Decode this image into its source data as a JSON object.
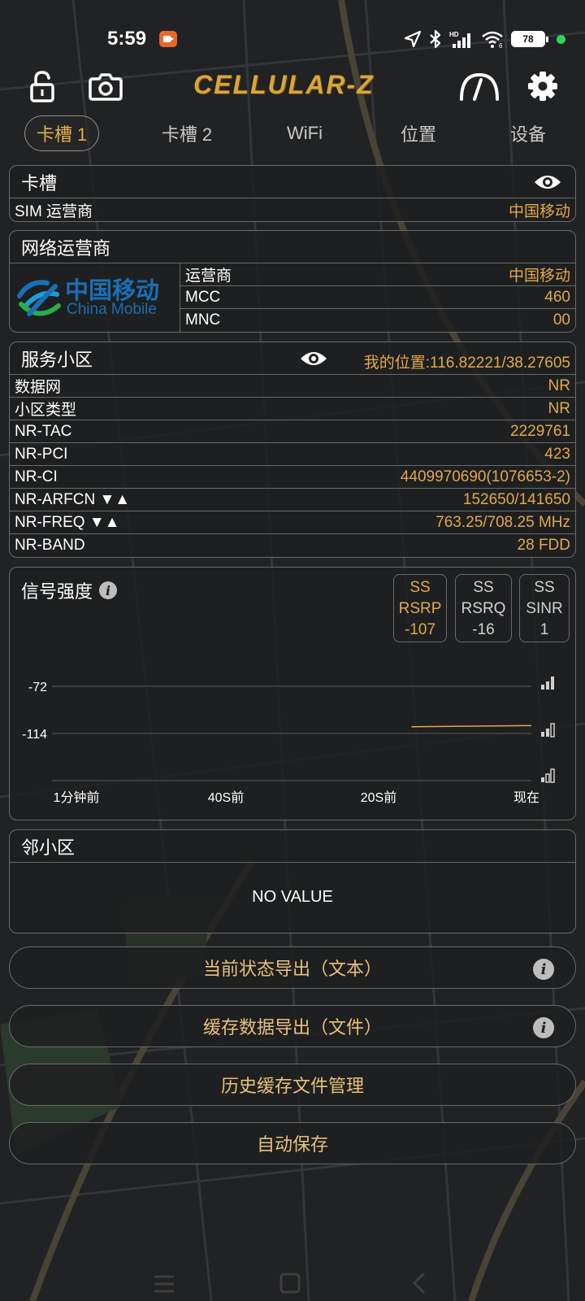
{
  "status_bar": {
    "time": "5:59",
    "battery": "78",
    "icons": [
      "recording-icon",
      "location-arrow-icon",
      "bluetooth-icon",
      "signal-hd-icon",
      "wifi-icon",
      "battery-icon"
    ]
  },
  "toolbar": {
    "app_title": "CELLULAR-Z",
    "icons": [
      "lock-icon",
      "camera-icon",
      "speedometer-icon",
      "gear-icon"
    ]
  },
  "tabs": [
    {
      "label": "卡槽 1",
      "active": true
    },
    {
      "label": "卡槽 2",
      "active": false
    },
    {
      "label": "WiFi",
      "active": false
    },
    {
      "label": "位置",
      "active": false
    },
    {
      "label": "设备",
      "active": false
    }
  ],
  "slot_card": {
    "title": "卡槽",
    "rows": [
      {
        "key": "SIM 运营商",
        "value": "中国移动"
      }
    ]
  },
  "operator_card": {
    "title": "网络运营商",
    "logo_cn": "中国移动",
    "logo_en": "China Mobile",
    "rows": [
      {
        "key": "运营商",
        "value": "中国移动"
      },
      {
        "key": "MCC",
        "value": "460"
      },
      {
        "key": "MNC",
        "value": "00"
      }
    ]
  },
  "serving_card": {
    "title": "服务小区",
    "location": "我的位置:116.82221/38.27605",
    "rows": [
      {
        "key": "数据网",
        "value": "NR"
      },
      {
        "key": "小区类型",
        "value": "NR"
      },
      {
        "key": "NR-TAC",
        "value": "2229761"
      },
      {
        "key": "NR-PCI",
        "value": "423"
      },
      {
        "key": "NR-CI",
        "value": "4409970690(1076653-2)"
      },
      {
        "key": "NR-ARFCN ▼▲",
        "value": "152650/141650"
      },
      {
        "key": "NR-FREQ ▼▲",
        "value": "763.25/708.25 MHz"
      },
      {
        "key": "NR-BAND",
        "value": "28 FDD"
      }
    ]
  },
  "signal_card": {
    "title": "信号强度",
    "metrics": [
      {
        "line1": "SS",
        "line2": "RSRP",
        "line3": "-107",
        "selected": true
      },
      {
        "line1": "SS",
        "line2": "RSRQ",
        "line3": "-16",
        "selected": false
      },
      {
        "line1": "SS",
        "line2": "SINR",
        "line3": "1",
        "selected": false
      }
    ]
  },
  "chart_data": {
    "type": "line",
    "y_ticks": [
      "-72",
      "-114"
    ],
    "x_labels": [
      "1分钟前",
      "40S前",
      "20S前",
      "现在"
    ],
    "series": [
      {
        "color": "#e0a94a",
        "x": [
          -15,
          0
        ],
        "y": [
          -108,
          -107
        ]
      }
    ],
    "xlim": [
      -60,
      0
    ],
    "ylim": [
      -156,
      -72
    ]
  },
  "neighbor_card": {
    "title": "邻小区",
    "empty_text": "NO VALUE"
  },
  "buttons": {
    "export_text": "当前状态导出（文本）",
    "export_file": "缓存数据导出（文件）",
    "history": "历史缓存文件管理",
    "autosave": "自动保存"
  },
  "colors": {
    "accent": "#e0a94a",
    "logo": "#d9a63a",
    "background": "#222324",
    "border": "#6a6a6a"
  }
}
